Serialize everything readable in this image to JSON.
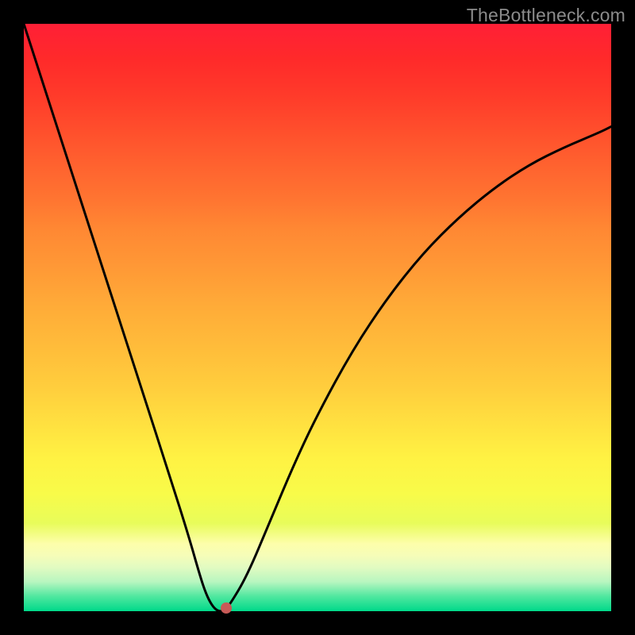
{
  "watermark": "TheBottleneck.com",
  "chart_data": {
    "type": "line",
    "title": "",
    "xlabel": "",
    "ylabel": "",
    "xlim": [
      0,
      1
    ],
    "ylim": [
      0,
      1
    ],
    "series": [
      {
        "name": "curve",
        "x": [
          0.0,
          0.05,
          0.1,
          0.15,
          0.2,
          0.25,
          0.28,
          0.3,
          0.31,
          0.32,
          0.33,
          0.34,
          0.35,
          0.38,
          0.42,
          0.46,
          0.5,
          0.56,
          0.62,
          0.68,
          0.74,
          0.8,
          0.86,
          0.92,
          0.98,
          1.0
        ],
        "y": [
          1.0,
          0.845,
          0.69,
          0.535,
          0.38,
          0.225,
          0.13,
          0.06,
          0.03,
          0.01,
          0.0,
          0.0,
          0.01,
          0.06,
          0.155,
          0.25,
          0.335,
          0.445,
          0.535,
          0.61,
          0.67,
          0.72,
          0.76,
          0.79,
          0.815,
          0.825
        ]
      }
    ],
    "marker": {
      "x": 0.345,
      "y": 0.005
    },
    "background_gradient": {
      "top": "#ff1f36",
      "middle": "#ffe040",
      "bottom": "#00d98a"
    }
  }
}
